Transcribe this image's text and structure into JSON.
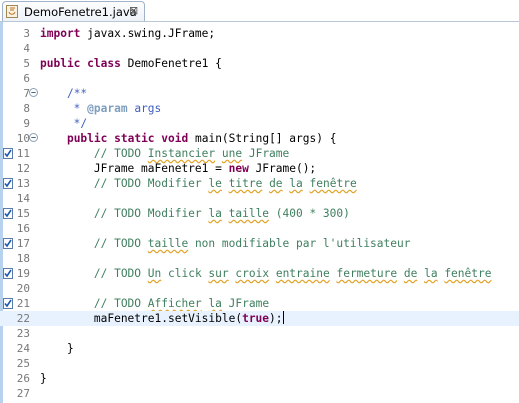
{
  "tab": {
    "filename": "DemoFenetre1.java",
    "close_glyph": "⊠"
  },
  "colors": {
    "keyword": "#7f0055",
    "comment": "#3f5fbf",
    "line_comment": "#3f7f5f",
    "javadoc_tag": "#7f9fbf",
    "current_line": "#e8f2fe"
  },
  "lines": [
    {
      "num": "3",
      "parts": [
        [
          "kw",
          "import"
        ],
        [
          "",
          "javax.swing.JFrame;"
        ]
      ]
    },
    {
      "num": "4",
      "parts": []
    },
    {
      "num": "5",
      "parts": [
        [
          "kw",
          "public"
        ],
        [
          "",
          ""
        ],
        [
          "kw",
          "class"
        ],
        [
          "",
          "DemoFenetre1 {"
        ]
      ]
    },
    {
      "num": "6",
      "parts": []
    },
    {
      "num": "7",
      "fold": "minus",
      "parts": [
        [
          "",
          "    "
        ],
        [
          "cm",
          "/**"
        ]
      ]
    },
    {
      "num": "8",
      "parts": [
        [
          "cm",
          "     * "
        ],
        [
          "tg",
          "@param"
        ],
        [
          "cm",
          " args"
        ]
      ]
    },
    {
      "num": "9",
      "parts": [
        [
          "cm",
          "     */"
        ]
      ]
    },
    {
      "num": "10",
      "fold": "minus",
      "parts": [
        [
          "",
          "    "
        ],
        [
          "kw",
          "public"
        ],
        [
          "",
          ""
        ],
        [
          "kw",
          "static"
        ],
        [
          "",
          ""
        ],
        [
          "kw",
          "void"
        ],
        [
          "",
          "main(String[] args) {"
        ]
      ]
    },
    {
      "num": "11",
      "task": true,
      "parts": [
        [
          "ln",
          "        // "
        ],
        [
          "ln",
          "TODO "
        ],
        [
          "lns",
          "Instancier"
        ],
        [
          "ln",
          " "
        ],
        [
          "lns",
          "une"
        ],
        [
          "ln",
          " JFrame"
        ]
      ]
    },
    {
      "num": "12",
      "parts": [
        [
          "",
          "        JFrame maFenetre1 = "
        ],
        [
          "kw",
          "new"
        ],
        [
          "",
          " JFrame();"
        ]
      ]
    },
    {
      "num": "13",
      "task": true,
      "parts": [
        [
          "ln",
          "        // TODO Modifier "
        ],
        [
          "lns",
          "le"
        ],
        [
          "ln",
          " "
        ],
        [
          "lns",
          "titre"
        ],
        [
          "ln",
          " "
        ],
        [
          "lns",
          "de"
        ],
        [
          "ln",
          " "
        ],
        [
          "lns",
          "la"
        ],
        [
          "ln",
          " "
        ],
        [
          "lns",
          "fenêtre"
        ]
      ]
    },
    {
      "num": "14",
      "parts": []
    },
    {
      "num": "15",
      "task": true,
      "parts": [
        [
          "ln",
          "        // TODO Modifier "
        ],
        [
          "lns",
          "la"
        ],
        [
          "ln",
          " "
        ],
        [
          "lns",
          "taille"
        ],
        [
          "ln",
          " (400 * 300)"
        ]
      ]
    },
    {
      "num": "16",
      "parts": []
    },
    {
      "num": "17",
      "task": true,
      "parts": [
        [
          "ln",
          "        // TODO "
        ],
        [
          "lns",
          "taille"
        ],
        [
          "ln",
          " non modifiable par l'utilisateur"
        ]
      ]
    },
    {
      "num": "18",
      "parts": []
    },
    {
      "num": "19",
      "task": true,
      "parts": [
        [
          "ln",
          "        // TODO "
        ],
        [
          "lns",
          "Un"
        ],
        [
          "ln",
          " click "
        ],
        [
          "lns",
          "sur"
        ],
        [
          "ln",
          " "
        ],
        [
          "lns",
          "croix"
        ],
        [
          "ln",
          " "
        ],
        [
          "lns",
          "entraine"
        ],
        [
          "ln",
          " "
        ],
        [
          "lns",
          "fermeture"
        ],
        [
          "ln",
          " "
        ],
        [
          "lns",
          "de"
        ],
        [
          "ln",
          " "
        ],
        [
          "lns",
          "la"
        ],
        [
          "ln",
          " "
        ],
        [
          "lns",
          "fenêtre"
        ]
      ]
    },
    {
      "num": "20",
      "parts": []
    },
    {
      "num": "21",
      "task": true,
      "parts": [
        [
          "ln",
          "        // TODO "
        ],
        [
          "lns",
          "Afficher"
        ],
        [
          "ln",
          " "
        ],
        [
          "lns",
          "la"
        ],
        [
          "ln",
          " JFrame"
        ]
      ]
    },
    {
      "num": "22",
      "current": true,
      "parts": [
        [
          "",
          "        maFenetre1.setVisible("
        ],
        [
          "kw",
          "true"
        ],
        [
          "",
          ");"
        ]
      ]
    },
    {
      "num": "23",
      "parts": []
    },
    {
      "num": "24",
      "parts": [
        [
          "",
          "    }"
        ]
      ]
    },
    {
      "num": "25",
      "parts": []
    },
    {
      "num": "26",
      "parts": [
        [
          "",
          "}"
        ]
      ]
    },
    {
      "num": "27",
      "parts": []
    }
  ]
}
